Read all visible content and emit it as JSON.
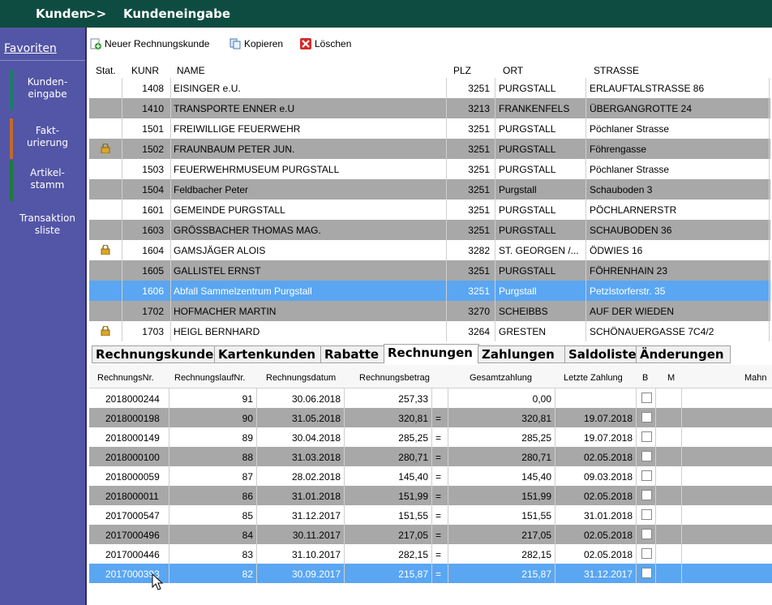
{
  "title": {
    "section": "Kunden",
    "separator": ">>",
    "page": "Kundeneingabe"
  },
  "sidebar": {
    "favorites": "Favoriten",
    "items": [
      {
        "label": "Kunden-eingabe",
        "line1": "Kunden-",
        "line2": "eingabe",
        "color": "#1e7b6a"
      },
      {
        "label": "Fakt-urierung",
        "line1": "Fakt-",
        "line2": "urierung",
        "color": "#c06a2a"
      },
      {
        "label": "Artikel-stamm",
        "line1": "Artikel-",
        "line2": "stamm",
        "color": "#1e7b3a"
      },
      {
        "label": "Transaktionsliste",
        "line1": "Transaktion",
        "line2": "sliste",
        "color": ""
      }
    ]
  },
  "toolbar": {
    "new_label": "Neuer Rechnungskunde",
    "copy_label": "Kopieren",
    "delete_label": "Löschen"
  },
  "customers": {
    "columns": [
      "Stat.",
      "KUNR",
      "NAME",
      "PLZ",
      "ORT",
      "STRASSE"
    ],
    "rows": [
      {
        "lock": false,
        "kunr": "1408",
        "name": "EISINGER e.U.",
        "plz": "3251",
        "ort": "PURGSTALL",
        "strasse": "ERLAUFTALSTRASSE 86"
      },
      {
        "lock": false,
        "kunr": "1410",
        "name": "TRANSPORTE ENNER e.U",
        "plz": "3213",
        "ort": "FRANKENFELS",
        "strasse": "ÜBERGANGROTTE 24"
      },
      {
        "lock": false,
        "kunr": "1501",
        "name": "FREIWILLIGE FEUERWEHR",
        "plz": "3251",
        "ort": "PURGSTALL",
        "strasse": "Pöchlaner Strasse"
      },
      {
        "lock": true,
        "kunr": "1502",
        "name": "FRAUNBAUM PETER JUN.",
        "plz": "3251",
        "ort": "PURGSTALL",
        "strasse": "Föhrengasse"
      },
      {
        "lock": false,
        "kunr": "1503",
        "name": "FEUERWEHRMUSEUM PURGSTALL",
        "plz": "3251",
        "ort": "PURGSTALL",
        "strasse": "Pöchlaner Strasse"
      },
      {
        "lock": false,
        "kunr": "1504",
        "name": "Feldbacher Peter",
        "plz": "3251",
        "ort": "Purgstall",
        "strasse": "Schauboden 3"
      },
      {
        "lock": false,
        "kunr": "1601",
        "name": "GEMEINDE PURGSTALL",
        "plz": "3251",
        "ort": "PURGSTALL",
        "strasse": "PÖCHLARNERSTR"
      },
      {
        "lock": false,
        "kunr": "1603",
        "name": "GRÖSSBACHER THOMAS MAG.",
        "plz": "3251",
        "ort": "PURGSTALL",
        "strasse": "SCHAUBODEN 36"
      },
      {
        "lock": true,
        "kunr": "1604",
        "name": "GAMSJÄGER ALOIS",
        "plz": "3282",
        "ort": "ST. GEORGEN /...",
        "strasse": "ÖDWIES 16"
      },
      {
        "lock": false,
        "kunr": "1605",
        "name": "GALLISTEL ERNST",
        "plz": "3251",
        "ort": "PURGSTALL",
        "strasse": "FÖHRENHAIN 23"
      },
      {
        "lock": false,
        "kunr": "1606",
        "name": "Abfall Sammelzentrum Purgstall",
        "plz": "3251",
        "ort": "Purgstall",
        "strasse": "Petzlstorferstr. 35",
        "selected": true
      },
      {
        "lock": false,
        "kunr": "1702",
        "name": "HOFMACHER MARTIN",
        "plz": "3270",
        "ort": "SCHEIBBS",
        "strasse": "AUF DER WIEDEN"
      },
      {
        "lock": true,
        "kunr": "1703",
        "name": "HEIGL BERNHARD",
        "plz": "3264",
        "ort": "GRESTEN",
        "strasse": "SCHÖNAUERGASSE 7C4/2"
      }
    ]
  },
  "tabs": [
    "Rechnungskunde",
    "Kartenkunden",
    "Rabatte",
    "Rechnungen",
    "Zahlungen",
    "Saldoliste",
    "Änderungen"
  ],
  "active_tab": "Rechnungen",
  "invoices": {
    "columns": [
      "RechnungsNr.",
      "RechnungslaufNr.",
      "Rechnungsdatum",
      "Rechnungsbetrag",
      "Gesamtzahlung",
      "Letzte Zahlung",
      "B",
      "M",
      "Mahn"
    ],
    "rows": [
      {
        "nr": "2018000244",
        "lauf": "91",
        "datum": "30.06.2018",
        "betrag": "257,33",
        "eq": "",
        "gesamt": "0,00",
        "letzte": ""
      },
      {
        "nr": "2018000198",
        "lauf": "90",
        "datum": "31.05.2018",
        "betrag": "320,81",
        "eq": "=",
        "gesamt": "320,81",
        "letzte": "19.07.2018"
      },
      {
        "nr": "2018000149",
        "lauf": "89",
        "datum": "30.04.2018",
        "betrag": "285,25",
        "eq": "=",
        "gesamt": "285,25",
        "letzte": "19.07.2018"
      },
      {
        "nr": "2018000100",
        "lauf": "88",
        "datum": "31.03.2018",
        "betrag": "280,71",
        "eq": "=",
        "gesamt": "280,71",
        "letzte": "02.05.2018"
      },
      {
        "nr": "2018000059",
        "lauf": "87",
        "datum": "28.02.2018",
        "betrag": "145,40",
        "eq": "=",
        "gesamt": "145,40",
        "letzte": "09.03.2018"
      },
      {
        "nr": "2018000011",
        "lauf": "86",
        "datum": "31.01.2018",
        "betrag": "151,99",
        "eq": "=",
        "gesamt": "151,99",
        "letzte": "02.05.2018"
      },
      {
        "nr": "2017000547",
        "lauf": "85",
        "datum": "31.12.2017",
        "betrag": "151,55",
        "eq": "=",
        "gesamt": "151,55",
        "letzte": "31.01.2018"
      },
      {
        "nr": "2017000496",
        "lauf": "84",
        "datum": "30.11.2017",
        "betrag": "217,05",
        "eq": "=",
        "gesamt": "217,05",
        "letzte": "02.05.2018"
      },
      {
        "nr": "2017000446",
        "lauf": "83",
        "datum": "31.10.2017",
        "betrag": "282,15",
        "eq": "=",
        "gesamt": "282,15",
        "letzte": "02.05.2018"
      },
      {
        "nr": "2017000393",
        "lauf": "82",
        "datum": "30.09.2017",
        "betrag": "215,87",
        "eq": "=",
        "gesamt": "215,87",
        "letzte": "31.12.2017",
        "selected": true
      }
    ]
  },
  "colors": {
    "title_bar": "#0e4c41",
    "sidebar": "#5355a6",
    "selection": "#5aa6f2",
    "alt_row": "#a8a8a8"
  }
}
